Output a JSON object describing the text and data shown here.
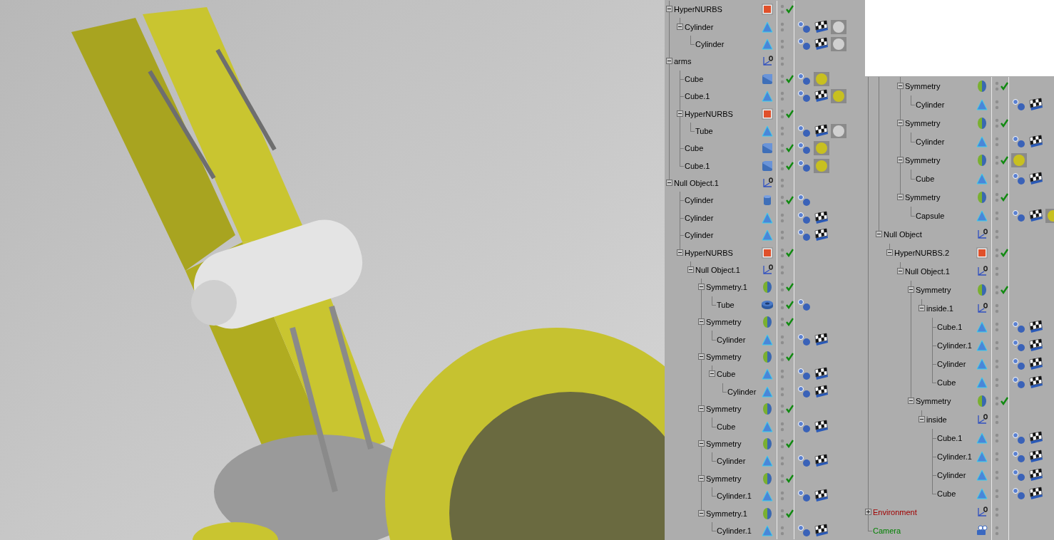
{
  "object_panels": [
    {
      "items": [
        {
          "name": "HyperNURBS",
          "kind": "hypernurbs",
          "expanded": true,
          "checked": true,
          "children": [
            {
              "name": "Cylinder",
              "kind": "polygon",
              "expanded": true,
              "checked": false,
              "tags": [
                {
                  "kind": "phong"
                },
                {
                  "kind": "texture"
                },
                {
                  "kind": "material",
                  "color": "#d0d0d0"
                }
              ],
              "children": [
                {
                  "name": "Cylinder",
                  "kind": "polygon",
                  "checked": false,
                  "tags": [
                    {
                      "kind": "phong"
                    },
                    {
                      "kind": "texture"
                    },
                    {
                      "kind": "material",
                      "color": "#d0d0d0"
                    }
                  ]
                }
              ]
            }
          ]
        },
        {
          "name": "arms",
          "kind": "null",
          "expanded": true,
          "checked": false,
          "children": [
            {
              "name": "Cube",
              "kind": "cube",
              "checked": true,
              "tags": [
                {
                  "kind": "phong"
                },
                {
                  "kind": "material",
                  "color": "#c8c020"
                }
              ]
            },
            {
              "name": "Cube.1",
              "kind": "polygon",
              "checked": false,
              "tags": [
                {
                  "kind": "phong"
                },
                {
                  "kind": "texture"
                },
                {
                  "kind": "material",
                  "color": "#c8c020"
                }
              ]
            },
            {
              "name": "HyperNURBS",
              "kind": "hypernurbs",
              "expanded": true,
              "checked": true,
              "children": [
                {
                  "name": "Tube",
                  "kind": "polygon",
                  "checked": false,
                  "tags": [
                    {
                      "kind": "phong"
                    },
                    {
                      "kind": "texture"
                    },
                    {
                      "kind": "material",
                      "color": "#d0d0d0"
                    }
                  ]
                }
              ]
            },
            {
              "name": "Cube",
              "kind": "cube",
              "checked": true,
              "tags": [
                {
                  "kind": "phong"
                },
                {
                  "kind": "material",
                  "color": "#c8c020"
                }
              ]
            },
            {
              "name": "Cube.1",
              "kind": "cube",
              "checked": true,
              "tags": [
                {
                  "kind": "phong"
                },
                {
                  "kind": "material",
                  "color": "#c8c020"
                }
              ]
            }
          ]
        },
        {
          "name": "Null Object.1",
          "kind": "null",
          "expanded": true,
          "checked": false,
          "children": [
            {
              "name": "Cylinder",
              "kind": "cylinder",
              "checked": true,
              "tags": [
                {
                  "kind": "phong"
                }
              ]
            },
            {
              "name": "Cylinder",
              "kind": "polygon",
              "checked": false,
              "tags": [
                {
                  "kind": "phong"
                },
                {
                  "kind": "texture"
                }
              ]
            },
            {
              "name": "Cylinder",
              "kind": "polygon",
              "checked": false,
              "tags": [
                {
                  "kind": "phong"
                },
                {
                  "kind": "texture"
                }
              ]
            },
            {
              "name": "HyperNURBS",
              "kind": "hypernurbs",
              "expanded": true,
              "checked": true,
              "children": [
                {
                  "name": "Null Object.1",
                  "kind": "null",
                  "expanded": true,
                  "checked": false,
                  "children": [
                    {
                      "name": "Symmetry.1",
                      "kind": "symmetry",
                      "expanded": true,
                      "checked": true,
                      "children": [
                        {
                          "name": "Tube",
                          "kind": "tube",
                          "checked": true,
                          "tags": [
                            {
                              "kind": "phong"
                            }
                          ]
                        }
                      ]
                    },
                    {
                      "name": "Symmetry",
                      "kind": "symmetry",
                      "expanded": true,
                      "checked": true,
                      "children": [
                        {
                          "name": "Cylinder",
                          "kind": "polygon",
                          "checked": false,
                          "tags": [
                            {
                              "kind": "phong"
                            },
                            {
                              "kind": "texture"
                            }
                          ]
                        }
                      ]
                    },
                    {
                      "name": "Symmetry",
                      "kind": "symmetry",
                      "expanded": true,
                      "checked": true,
                      "children": [
                        {
                          "name": "Cube",
                          "kind": "polygon",
                          "expanded": true,
                          "checked": false,
                          "tags": [
                            {
                              "kind": "phong"
                            },
                            {
                              "kind": "texture"
                            }
                          ],
                          "children": [
                            {
                              "name": "Cylinder",
                              "kind": "polygon",
                              "checked": false,
                              "tags": [
                                {
                                  "kind": "phong"
                                },
                                {
                                  "kind": "texture"
                                }
                              ]
                            }
                          ]
                        }
                      ]
                    },
                    {
                      "name": "Symmetry",
                      "kind": "symmetry",
                      "expanded": true,
                      "checked": true,
                      "children": [
                        {
                          "name": "Cube",
                          "kind": "polygon",
                          "checked": false,
                          "tags": [
                            {
                              "kind": "phong"
                            },
                            {
                              "kind": "texture"
                            }
                          ]
                        }
                      ]
                    },
                    {
                      "name": "Symmetry",
                      "kind": "symmetry",
                      "expanded": true,
                      "checked": true,
                      "children": [
                        {
                          "name": "Cylinder",
                          "kind": "polygon",
                          "checked": false,
                          "tags": [
                            {
                              "kind": "phong"
                            },
                            {
                              "kind": "texture"
                            }
                          ]
                        }
                      ]
                    },
                    {
                      "name": "Symmetry",
                      "kind": "symmetry",
                      "expanded": true,
                      "checked": true,
                      "children": [
                        {
                          "name": "Cylinder.1",
                          "kind": "polygon",
                          "checked": false,
                          "tags": [
                            {
                              "kind": "phong"
                            },
                            {
                              "kind": "texture"
                            }
                          ]
                        }
                      ]
                    },
                    {
                      "name": "Symmetry.1",
                      "kind": "symmetry",
                      "expanded": true,
                      "checked": true,
                      "children": [
                        {
                          "name": "Cylinder.1",
                          "kind": "polygon",
                          "checked": false,
                          "tags": [
                            {
                              "kind": "phong"
                            },
                            {
                              "kind": "texture"
                            }
                          ]
                        }
                      ]
                    }
                  ]
                }
              ]
            }
          ]
        }
      ]
    },
    {
      "items": [
        {
          "children": [
            {
              "children": [
                {
                  "children": [
                    {
                      "name": "Symmetry",
                      "kind": "symmetry",
                      "expanded": true,
                      "checked": true,
                      "children": [
                        {
                          "name": "Cylinder",
                          "kind": "polygon",
                          "checked": false,
                          "tags": [
                            {
                              "kind": "phong"
                            },
                            {
                              "kind": "texture"
                            }
                          ]
                        }
                      ]
                    },
                    {
                      "name": "Symmetry",
                      "kind": "symmetry",
                      "expanded": true,
                      "checked": true,
                      "children": [
                        {
                          "name": "Cylinder",
                          "kind": "polygon",
                          "checked": false,
                          "tags": [
                            {
                              "kind": "phong"
                            },
                            {
                              "kind": "texture"
                            }
                          ]
                        }
                      ]
                    },
                    {
                      "name": "Symmetry",
                      "kind": "symmetry",
                      "expanded": true,
                      "checked": true,
                      "tags": [
                        {
                          "kind": "material",
                          "color": "#c8c020"
                        }
                      ],
                      "children": [
                        {
                          "name": "Cube",
                          "kind": "polygon",
                          "checked": false,
                          "tags": [
                            {
                              "kind": "phong"
                            },
                            {
                              "kind": "texture"
                            }
                          ]
                        }
                      ]
                    },
                    {
                      "name": "Symmetry",
                      "kind": "symmetry",
                      "expanded": true,
                      "checked": true,
                      "children": [
                        {
                          "name": "Capsule",
                          "kind": "polygon",
                          "checked": false,
                          "tags": [
                            {
                              "kind": "phong"
                            },
                            {
                              "kind": "texture"
                            },
                            {
                              "kind": "material",
                              "color": "#c8c020"
                            }
                          ]
                        }
                      ]
                    }
                  ]
                }
              ]
            },
            {
              "name": "Null Object",
              "kind": "null",
              "expanded": true,
              "checked": false,
              "children": [
                {
                  "name": "HyperNURBS.2",
                  "kind": "hypernurbs",
                  "expanded": true,
                  "checked": true,
                  "children": [
                    {
                      "name": "Null Object.1",
                      "kind": "null",
                      "expanded": true,
                      "checked": false,
                      "children": [
                        {
                          "name": "Symmetry",
                          "kind": "symmetry",
                          "expanded": true,
                          "checked": true,
                          "children": [
                            {
                              "name": "inside.1",
                              "kind": "null",
                              "expanded": true,
                              "checked": false,
                              "children": [
                                {
                                  "name": "Cube.1",
                                  "kind": "polygon",
                                  "checked": false,
                                  "tags": [
                                    {
                                      "kind": "phong"
                                    },
                                    {
                                      "kind": "texture"
                                    }
                                  ]
                                },
                                {
                                  "name": "Cylinder.1",
                                  "kind": "polygon",
                                  "checked": false,
                                  "tags": [
                                    {
                                      "kind": "phong"
                                    },
                                    {
                                      "kind": "texture"
                                    }
                                  ]
                                },
                                {
                                  "name": "Cylinder",
                                  "kind": "polygon",
                                  "checked": false,
                                  "tags": [
                                    {
                                      "kind": "phong"
                                    },
                                    {
                                      "kind": "texture"
                                    }
                                  ]
                                },
                                {
                                  "name": "Cube",
                                  "kind": "polygon",
                                  "checked": false,
                                  "tags": [
                                    {
                                      "kind": "phong"
                                    },
                                    {
                                      "kind": "texture"
                                    }
                                  ]
                                }
                              ]
                            }
                          ]
                        },
                        {
                          "name": "Symmetry",
                          "kind": "symmetry",
                          "expanded": true,
                          "checked": true,
                          "children": [
                            {
                              "name": "inside",
                              "kind": "null",
                              "expanded": true,
                              "checked": false,
                              "children": [
                                {
                                  "name": "Cube.1",
                                  "kind": "polygon",
                                  "checked": false,
                                  "tags": [
                                    {
                                      "kind": "phong"
                                    },
                                    {
                                      "kind": "texture"
                                    }
                                  ]
                                },
                                {
                                  "name": "Cylinder.1",
                                  "kind": "polygon",
                                  "checked": false,
                                  "tags": [
                                    {
                                      "kind": "phong"
                                    },
                                    {
                                      "kind": "texture"
                                    }
                                  ]
                                },
                                {
                                  "name": "Cylinder",
                                  "kind": "polygon",
                                  "checked": false,
                                  "tags": [
                                    {
                                      "kind": "phong"
                                    },
                                    {
                                      "kind": "texture"
                                    }
                                  ]
                                },
                                {
                                  "name": "Cube",
                                  "kind": "polygon",
                                  "checked": false,
                                  "tags": [
                                    {
                                      "kind": "phong"
                                    },
                                    {
                                      "kind": "texture"
                                    }
                                  ]
                                }
                              ]
                            }
                          ]
                        }
                      ]
                    }
                  ]
                }
              ]
            }
          ]
        },
        {
          "name": "Environment",
          "kind": "null",
          "expanded": false,
          "checked": false,
          "color": "#a00000"
        },
        {
          "name": "Camera",
          "kind": "camera",
          "checked": false,
          "color": "#008000"
        }
      ]
    }
  ]
}
